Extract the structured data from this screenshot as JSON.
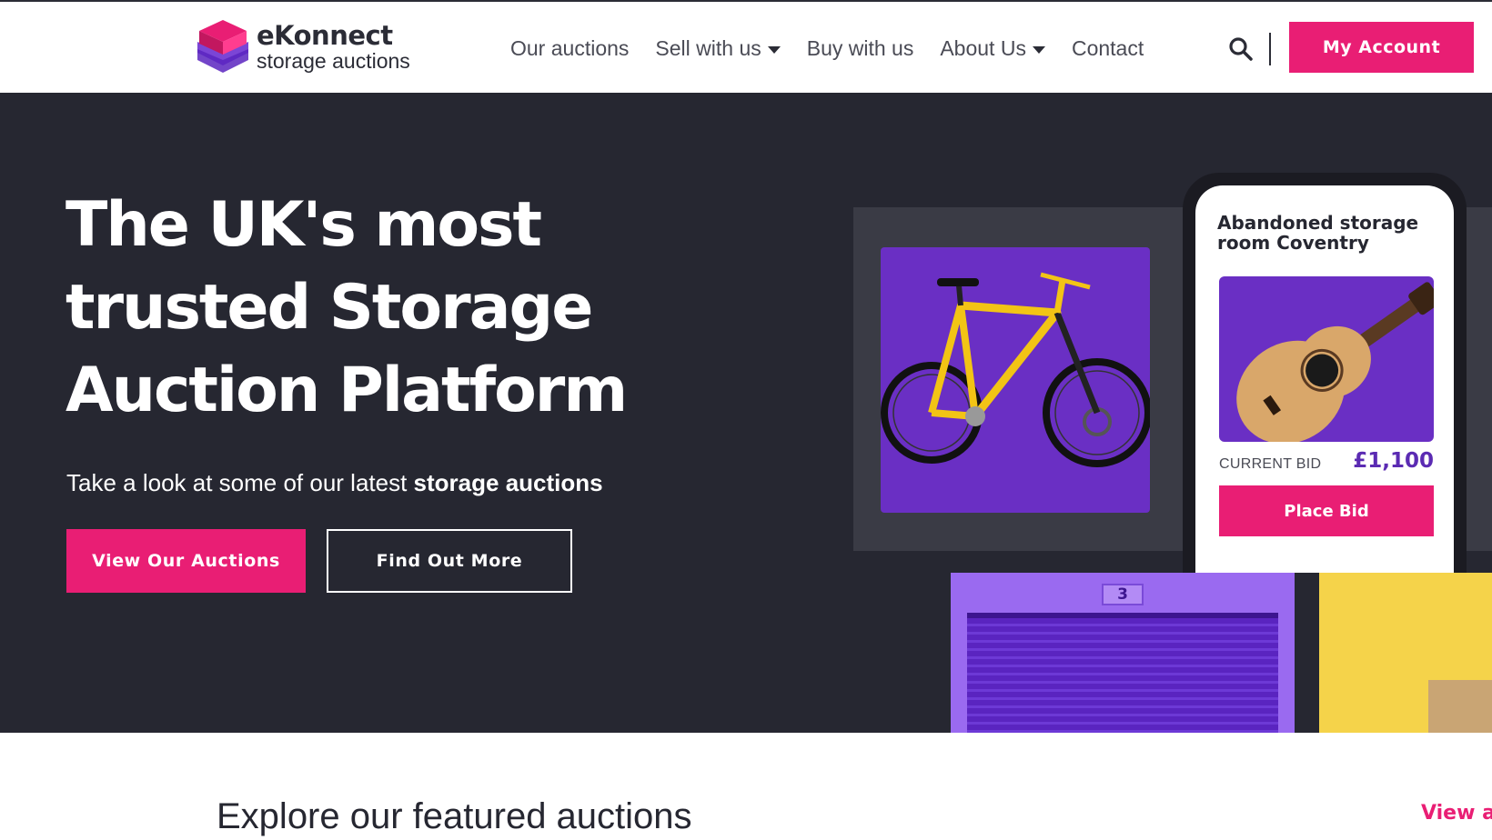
{
  "brand": {
    "name": "eKonnect",
    "tagline": "storage auctions",
    "colors": {
      "pink": "#e91e74",
      "purple": "#6a2fc4",
      "dark": "#262731"
    }
  },
  "nav": {
    "items": [
      {
        "label": "Our auctions",
        "has_dropdown": false
      },
      {
        "label": "Sell with us",
        "has_dropdown": true
      },
      {
        "label": "Buy with us",
        "has_dropdown": false
      },
      {
        "label": "About Us",
        "has_dropdown": true
      },
      {
        "label": "Contact",
        "has_dropdown": false
      }
    ],
    "search_icon": "search-icon",
    "account_label": "My Account"
  },
  "hero": {
    "title": "The UK's most trusted Storage Auction Platform",
    "subtitle_prefix": "Take a look at some of our latest ",
    "subtitle_bold": "storage auctions",
    "primary_button": "View Our Auctions",
    "secondary_button": "Find Out More",
    "phone_card": {
      "title": "Abandoned storage room Coventry",
      "bid_label": "CURRENT BID",
      "bid_value": "£1,100",
      "button": "Place Bid"
    },
    "unit_number": "3"
  },
  "featured": {
    "heading": "Explore our featured auctions",
    "view_all": "View al"
  }
}
